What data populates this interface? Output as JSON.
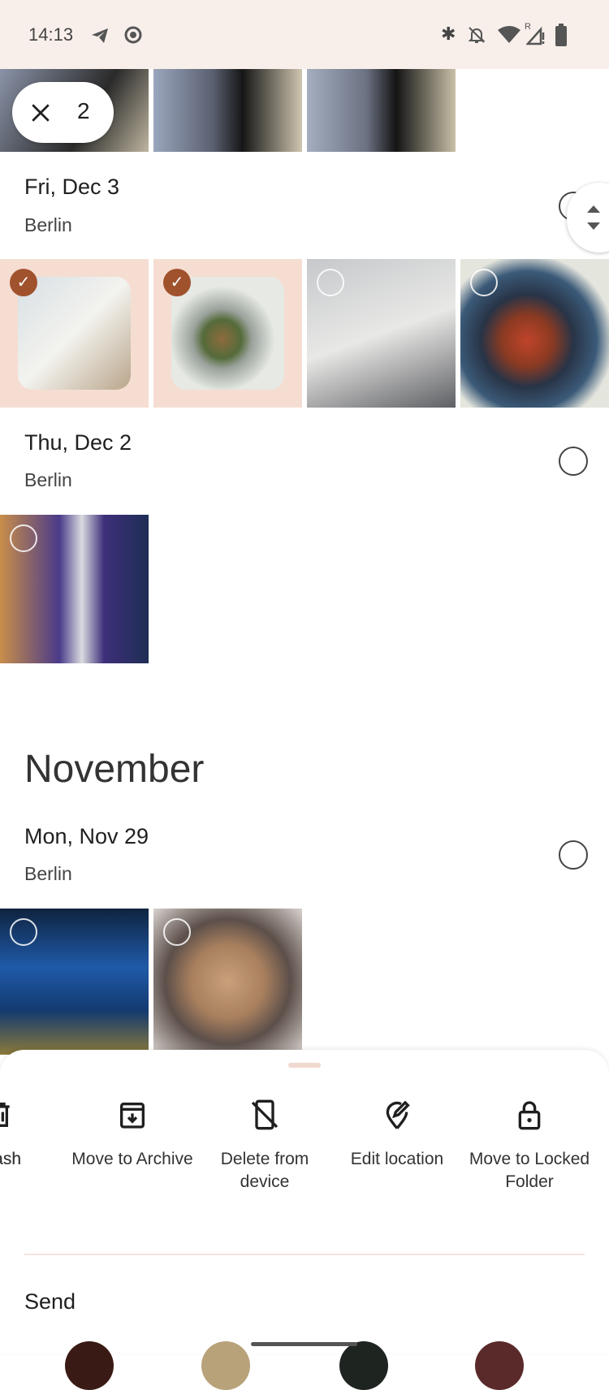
{
  "status_bar": {
    "time": "14:13",
    "icons": [
      "telegram-icon",
      "screen-record-icon",
      "bluetooth-icon",
      "bell-off-icon",
      "wifi-icon",
      "signal-roaming-icon",
      "battery-icon"
    ],
    "roaming_label": "R"
  },
  "selection": {
    "count": "2",
    "close_icon": "close-icon"
  },
  "sections": [
    {
      "date": "Fri, Dec 3",
      "location": "Berlin",
      "photos": [
        {
          "selected": true
        },
        {
          "selected": true
        },
        {
          "selected": false
        },
        {
          "selected": false
        }
      ]
    },
    {
      "date": "Thu, Dec 2",
      "location": "Berlin",
      "photos": [
        {
          "selected": false
        }
      ]
    },
    {
      "month": "November",
      "date": "Mon, Nov 29",
      "location": "Berlin",
      "photos": [
        {
          "selected": false
        },
        {
          "selected": false
        }
      ]
    }
  ],
  "actions": [
    {
      "label": "Trash",
      "visible_label": "ash",
      "icon": "trash-icon"
    },
    {
      "label": "Move to Archive",
      "icon": "archive-icon"
    },
    {
      "label": "Delete from device",
      "icon": "delete-from-device-icon"
    },
    {
      "label": "Edit location",
      "icon": "edit-location-icon"
    },
    {
      "label": "Move to Locked Folder",
      "icon": "lock-icon"
    }
  ],
  "send": {
    "title": "Send"
  },
  "colors": {
    "accent": "#a0522d",
    "status_bg": "#f8efea",
    "selected_bg": "#f6ddd2"
  }
}
